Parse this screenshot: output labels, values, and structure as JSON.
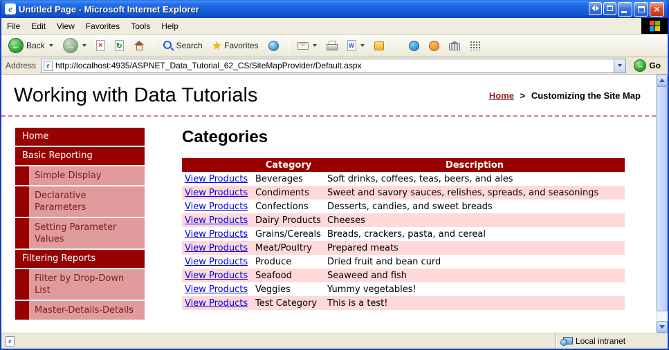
{
  "window": {
    "title": "Untitled Page - Microsoft Internet Explorer"
  },
  "menu": {
    "items": [
      "File",
      "Edit",
      "View",
      "Favorites",
      "Tools",
      "Help"
    ]
  },
  "toolbar": {
    "back_label": "Back",
    "search_label": "Search",
    "favorites_label": "Favorites"
  },
  "address": {
    "label": "Address",
    "url": "http://localhost:4935/ASPNET_Data_Tutorial_62_CS/SiteMapProvider/Default.aspx",
    "go_label": "Go"
  },
  "header": {
    "title": "Working with Data Tutorials",
    "breadcrumb_home": "Home",
    "breadcrumb_sep": ">",
    "breadcrumb_current": "Customizing the Site Map"
  },
  "sidebar": {
    "items": [
      {
        "label": "Home",
        "level": 1
      },
      {
        "label": "Basic Reporting",
        "level": 1
      },
      {
        "label": "Simple Display",
        "level": 2
      },
      {
        "label": "Declarative Parameters",
        "level": 2
      },
      {
        "label": "Setting Parameter Values",
        "level": 2
      },
      {
        "label": "Filtering Reports",
        "level": 1
      },
      {
        "label": "Filter by Drop-Down List",
        "level": 2
      },
      {
        "label": "Master-Details-Details",
        "level": 2
      }
    ]
  },
  "content": {
    "heading": "Categories",
    "table": {
      "headers": [
        "",
        "Category",
        "Description"
      ],
      "link_label": "View Products",
      "rows": [
        {
          "category": "Beverages",
          "description": "Soft drinks, coffees, teas, beers, and ales"
        },
        {
          "category": "Condiments",
          "description": "Sweet and savory sauces, relishes, spreads, and seasonings"
        },
        {
          "category": "Confections",
          "description": "Desserts, candies, and sweet breads"
        },
        {
          "category": "Dairy Products",
          "description": "Cheeses"
        },
        {
          "category": "Grains/Cereals",
          "description": "Breads, crackers, pasta, and cereal"
        },
        {
          "category": "Meat/Poultry",
          "description": "Prepared meats"
        },
        {
          "category": "Produce",
          "description": "Dried fruit and bean curd"
        },
        {
          "category": "Seafood",
          "description": "Seaweed and fish"
        },
        {
          "category": "Veggies",
          "description": "Yummy vegetables!"
        },
        {
          "category": "Test Category",
          "description": "This is a test!"
        }
      ]
    }
  },
  "status": {
    "zone": "Local intranet"
  },
  "icons": {
    "ie": "e",
    "close": "×",
    "back_arrow": "←",
    "forward_arrow": "→",
    "stop": "×",
    "refresh": "↻",
    "star": "★",
    "go_arrow": "→",
    "word": "W"
  },
  "colors": {
    "accent_dark_red": "#990000",
    "sub_item_pink": "#e09c9c",
    "row_alt_pink": "#ffd9d9",
    "link_blue": "#0000ee",
    "titlebar_blue": "#1660e8"
  }
}
